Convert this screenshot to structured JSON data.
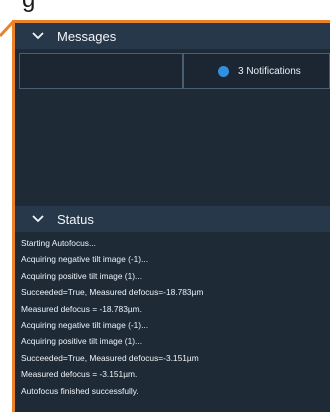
{
  "top_text": "g",
  "messages": {
    "title": "Messages",
    "notifications_label": "3 Notifications"
  },
  "status": {
    "title": "Status",
    "log": [
      "Starting Autofocus...",
      "Acquiring negative tilt image (-1)...",
      "Acquiring positive tilt image (1)...",
      "Succeeded=True, Measured defocus=-18.783µm",
      "Measured defocus = -18.783µm.",
      "Acquiring negative tilt image (-1)...",
      "Acquiring positive tilt image (1)...",
      "Succeeded=True, Measured defocus=-3.151µm",
      "Measured defocus = -3.151µm.",
      "Autofocus finished successfully."
    ]
  },
  "colors": {
    "accent_orange": "#e8832a",
    "panel_bg": "#1e2a36",
    "header_bg": "#26384a",
    "info_blue": "#2f8fe0"
  },
  "icons": {
    "section_toggle": "chevron-down-icon",
    "notification": "info-icon"
  }
}
